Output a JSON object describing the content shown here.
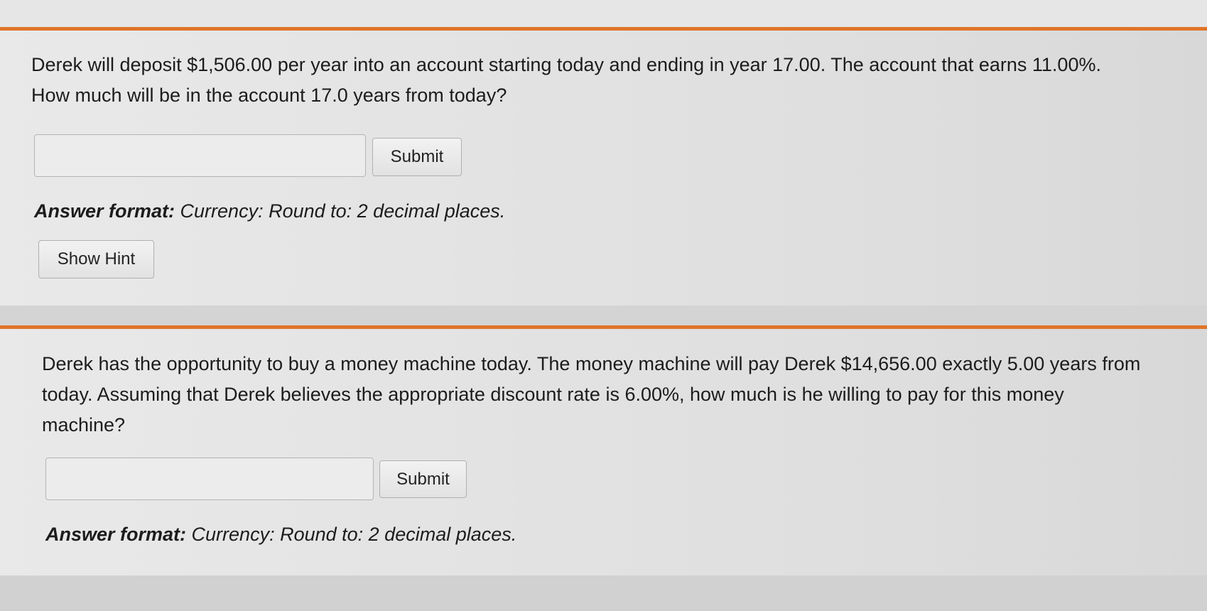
{
  "questions": [
    {
      "text": "Derek will deposit $1,506.00 per year into an account starting today and ending in year 17.00. The account that earns 11.00%. How much will be in the account 17.0 years from today?",
      "answer_value": "",
      "submit_label": "Submit",
      "answer_format_label": "Answer format:",
      "answer_format_text": "Currency: Round to: 2 decimal places.",
      "hint_label": "Show Hint"
    },
    {
      "text": "Derek has the opportunity to buy a money machine today. The money machine will pay Derek $14,656.00 exactly 5.00 years from today. Assuming that Derek believes the appropriate discount rate is 6.00%, how much is he willing to pay for this money machine?",
      "answer_value": "",
      "submit_label": "Submit",
      "answer_format_label": "Answer format:",
      "answer_format_text": "Currency: Round to: 2 decimal places."
    }
  ],
  "colors": {
    "accent": "#e07428",
    "background": "#e4e4e4",
    "text": "#1c1c1c"
  }
}
